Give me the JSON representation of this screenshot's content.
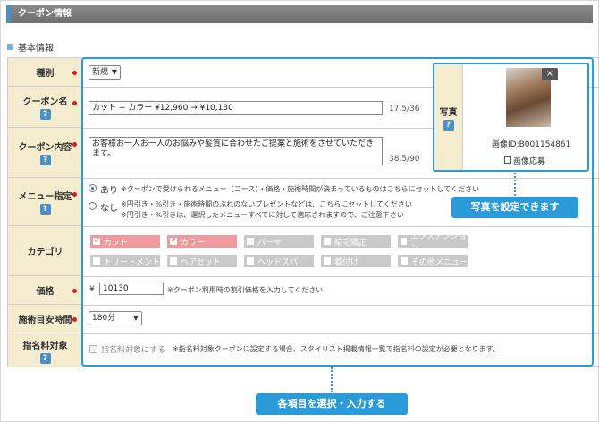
{
  "header": {
    "title": "クーポン情報"
  },
  "section": {
    "title": "基本情報"
  },
  "fields": {
    "type": {
      "label": "種別",
      "value": "新規"
    },
    "name": {
      "label": "クーポン名",
      "value": "カット + カラー ¥12,960 → ¥10,130",
      "counter": "17.5/36"
    },
    "content": {
      "label": "クーポン内容",
      "value": "お客様お一人お一人のお悩みや髪質に合わせたご提案と施術をさせていただきます。",
      "counter": "38.5/90"
    },
    "menu": {
      "label": "メニュー指定",
      "opt1_label": "あり",
      "opt1_note": "※クーポンで受けられるメニュー（コース）・価格・施術時間が決まっているものはこちらにセットしてください",
      "opt2_label": "なし",
      "opt2_note1": "※円引き・%引き・施術時間のぶれのないプレゼントなどは、こちらにセットしてください",
      "opt2_note2": "※円引き・%引きは、選択したメニューすべてに対して適応されますので、ご注意下さい"
    },
    "category": {
      "label": "カテゴリ",
      "items": [
        {
          "label": "カット",
          "checked": true
        },
        {
          "label": "カラー",
          "checked": true
        },
        {
          "label": "パーマ",
          "checked": false
        },
        {
          "label": "縮毛矯正",
          "checked": false
        },
        {
          "label": "エクステンション",
          "checked": false
        },
        {
          "label": "トリートメント",
          "checked": false
        },
        {
          "label": "ヘアセット",
          "checked": false
        },
        {
          "label": "ヘッドスパ",
          "checked": false
        },
        {
          "label": "着付け",
          "checked": false
        },
        {
          "label": "その他メニュー",
          "checked": false
        }
      ]
    },
    "price": {
      "label": "価格",
      "currency": "¥",
      "value": "10130",
      "note": "※クーポン利用時の割引価格を入力してください"
    },
    "time": {
      "label": "施術目安時間",
      "value": "180分"
    },
    "nomination": {
      "label": "指名料対象",
      "checkbox_label": "指名料対象にする",
      "note": "※指名料対象クーポンに設定する場合、スタイリスト掲載情報一覧で指名料の設定が必要となります。"
    }
  },
  "photo": {
    "label": "写真",
    "close": "×",
    "image_id": "画像ID:B001154861",
    "apply_label": "画像応募"
  },
  "callouts": {
    "photo": "写真を設定できます",
    "fields": "各項目を選択・入力する"
  },
  "colors": {
    "accent": "#2a9bd8",
    "label_bg": "#f6ecd0",
    "checked_cat": "#f09aa0",
    "unchecked_cat": "#c9c9c9",
    "required_dot": "#d62020"
  }
}
